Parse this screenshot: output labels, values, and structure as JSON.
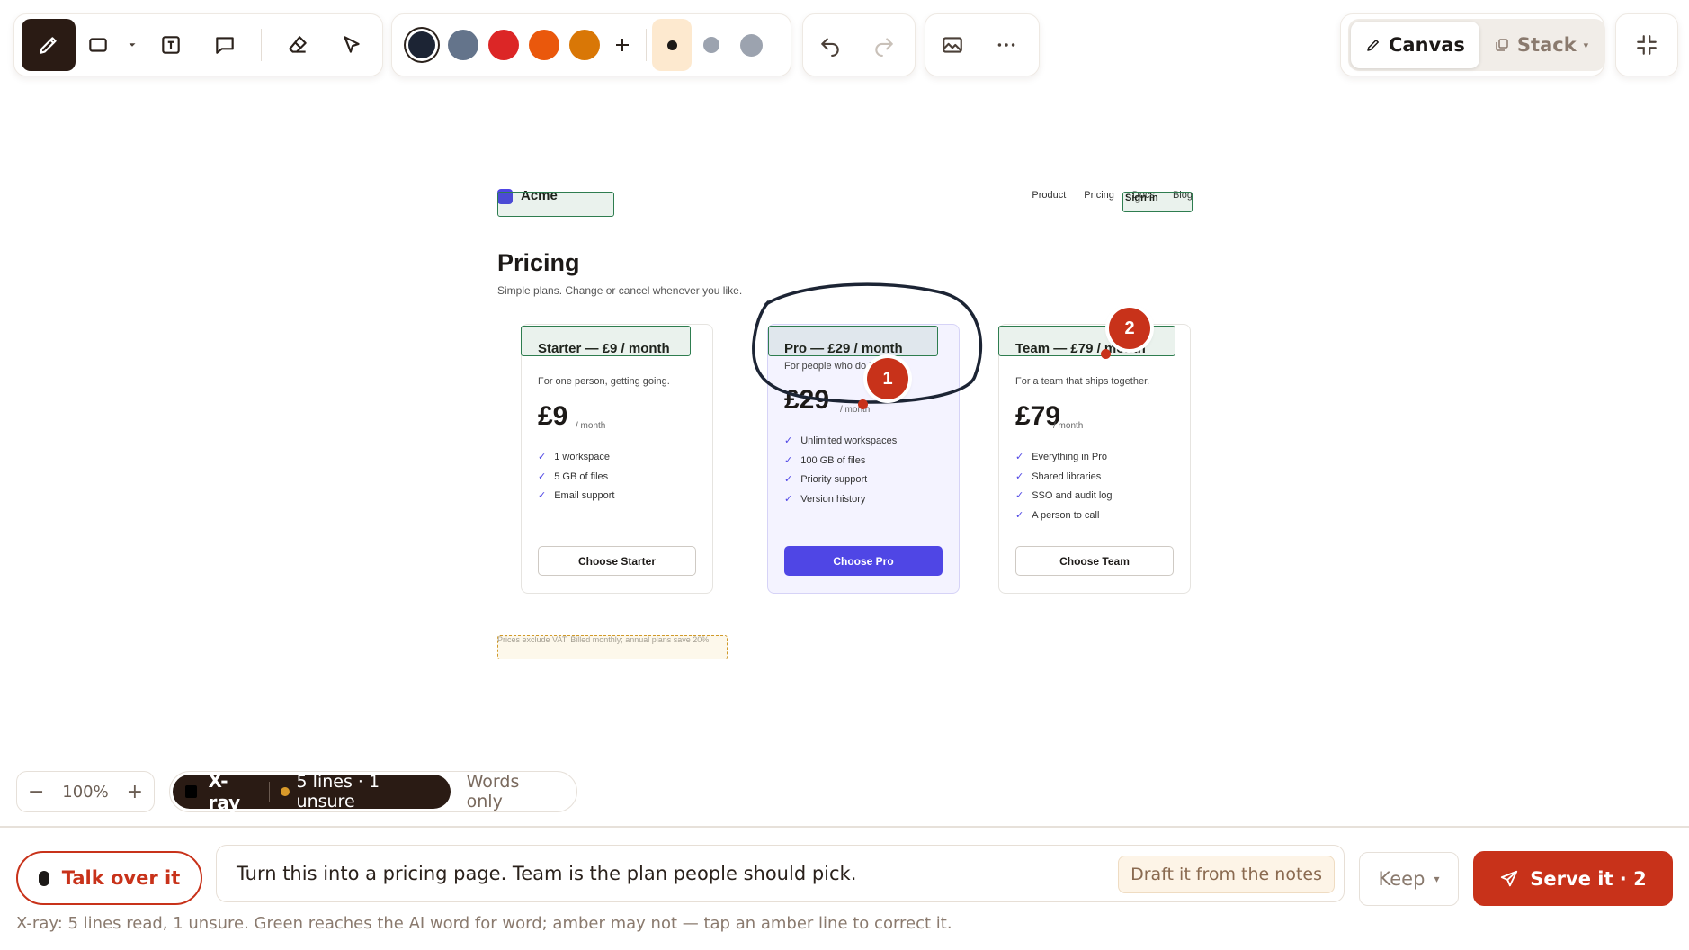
{
  "toolbar": {
    "tools": [
      {
        "name": "pen-tool",
        "icon": "pencil-icon",
        "active": true
      },
      {
        "name": "rectangle-tool",
        "icon": "rectangle-icon"
      },
      {
        "name": "text-tool",
        "icon": "text-box-icon"
      },
      {
        "name": "comment-tool",
        "icon": "speech-bubble-icon"
      },
      {
        "name": "eraser-tool",
        "icon": "eraser-icon"
      },
      {
        "name": "select-tool",
        "icon": "pointer-icon"
      }
    ],
    "colors": [
      "#1c2434",
      "#64748b",
      "#dc2626",
      "#ea580c",
      "#d97706"
    ],
    "selected_color": "#1c2434",
    "stroke_sizes": [
      "small",
      "medium",
      "large"
    ],
    "selected_size": "small",
    "view": {
      "canvas_label": "Canvas",
      "stack_label": "Stack",
      "active": "Canvas"
    }
  },
  "mockup": {
    "logo": "Acme",
    "nav_links": [
      "Product",
      "Pricing",
      "Docs",
      "Blog"
    ],
    "sign_in": "Sign in",
    "title": "Pricing",
    "subtitle": "Simple plans. Change or cancel whenever you like.",
    "plans": [
      {
        "title": "Starter — £9 / month",
        "desc": "For one person, getting going.",
        "price": "£9",
        "per": "/ month",
        "features": [
          "1 workspace",
          "5 GB of files",
          "Email support"
        ],
        "button": "Choose Starter"
      },
      {
        "title": "Pro — £29 / month",
        "desc": "For people who do it all day.",
        "price": "£29",
        "per": "/ month",
        "features": [
          "Unlimited workspaces",
          "100 GB of files",
          "Priority support",
          "Version history"
        ],
        "button": "Choose Pro"
      },
      {
        "title": "Team — £79 / month",
        "desc": "For a team that ships together.",
        "price": "£79",
        "per": "/ month",
        "features": [
          "Everything in Pro",
          "Shared libraries",
          "SSO and audit log",
          "A person to call"
        ],
        "button": "Choose Team"
      }
    ],
    "footnote": "Prices exclude VAT. Billed monthly; annual plans save 20%.",
    "check": "✓"
  },
  "annotations": {
    "pins": [
      "1",
      "2"
    ]
  },
  "controls": {
    "zoom_minus": "−",
    "zoom_level": "100%",
    "zoom_plus": "+",
    "xray_label": "X-ray",
    "xray_stats": "5 lines · 1 unsure",
    "words_only": "Words only"
  },
  "composer": {
    "talk_label": "Talk over it",
    "prompt_text": "Turn this into a pricing page. Team is the plan people should pick.",
    "draft_label": "Draft it from the notes",
    "keep_label": "Keep",
    "serve_label": "Serve it · 2",
    "status": "X-ray: 5 lines read, 1 unsure. Green reaches the AI word for word; amber may not — tap an amber line to correct it."
  }
}
